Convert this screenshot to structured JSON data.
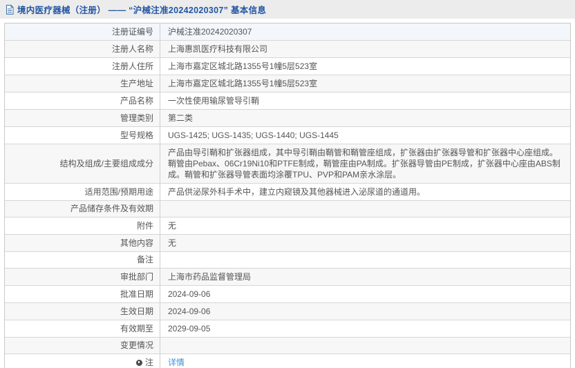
{
  "header": {
    "icon": "document-icon",
    "title": "境内医疗器械（注册） ——  “沪械注准20242020307”  基本信息"
  },
  "colors": {
    "header_background": "#ececec",
    "header_text": "#2155a3",
    "link": "#3d8fd8",
    "row_stripe": "#f7f7f7",
    "first_row_highlight": "#f3f6fb",
    "border": "#cccccc",
    "body_text": "#555555"
  },
  "table": {
    "rows": [
      {
        "label": "注册证编号",
        "value": "沪械注准20242020307"
      },
      {
        "label": "注册人名称",
        "value": "上海惠凯医疗科技有限公司"
      },
      {
        "label": "注册人住所",
        "value": "上海市嘉定区城北路1355号1幢5层523室"
      },
      {
        "label": "生产地址",
        "value": "上海市嘉定区城北路1355号1幢5层523室"
      },
      {
        "label": "产品名称",
        "value": "一次性使用输尿管导引鞘"
      },
      {
        "label": "管理类别",
        "value": "第二类"
      },
      {
        "label": "型号规格",
        "value": "UGS-1425; UGS-1435; UGS-1440; UGS-1445"
      },
      {
        "label": "结构及组成/主要组成成分",
        "value": "产品由导引鞘和扩张器组成，其中导引鞘由鞘管和鞘管座组成，扩张器由扩张器导管和扩张器中心座组成。鞘管由Pebax、06Cr19Ni10和PTFE制成，鞘管座由PA制成。扩张器导管由PE制成，扩张器中心座由ABS制成。鞘管和扩张器导管表面均涂覆TPU、PVP和PAM亲水涂层。"
      },
      {
        "label": "适用范围/预期用途",
        "value": "产品供泌尿外科手术中，建立内窥镜及其他器械进入泌尿道的通道用。"
      },
      {
        "label": "产品储存条件及有效期",
        "value": ""
      },
      {
        "label": "附件",
        "value": "无"
      },
      {
        "label": "其他内容",
        "value": "无"
      },
      {
        "label": "备注",
        "value": ""
      },
      {
        "label": "审批部门",
        "value": "上海市药品监督管理局"
      },
      {
        "label": "批准日期",
        "value": "2024-09-06"
      },
      {
        "label": "生效日期",
        "value": "2024-09-06"
      },
      {
        "label": "有效期至",
        "value": "2029-09-05"
      },
      {
        "label": "变更情况",
        "value": ""
      },
      {
        "label": "注",
        "label_icon": "note-icon",
        "value": "详情",
        "link": true
      }
    ]
  }
}
